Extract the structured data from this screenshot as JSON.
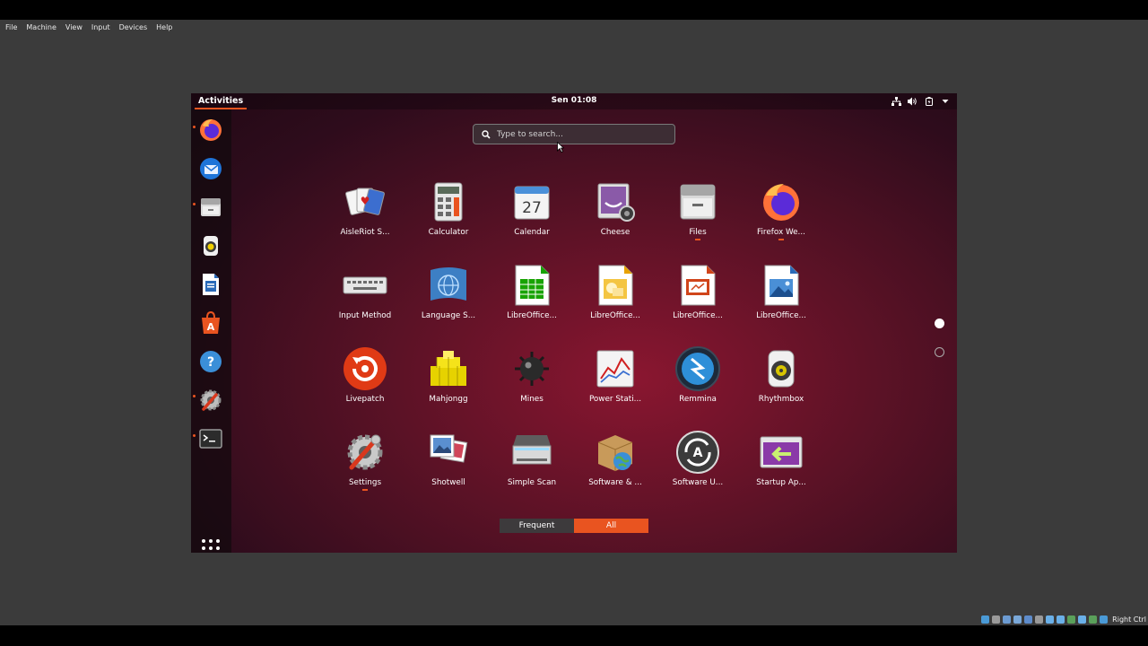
{
  "host": {
    "menu": [
      "File",
      "Machine",
      "View",
      "Input",
      "Devices",
      "Help"
    ],
    "host_key": "Right Ctrl",
    "status_icon_colors": [
      "#4a9ad6",
      "#9a9a9a",
      "#6c9bd2",
      "#7aa8d8",
      "#5e8ccb",
      "#9a9a9a",
      "#6ab0e8",
      "#6ab0e8",
      "#5aa05a",
      "#6ab0e8",
      "#5aa05a",
      "#4a9ad6"
    ]
  },
  "topbar": {
    "activities": "Activities",
    "clock": "Sen 01:08",
    "tray_icons": [
      "network-icon",
      "volume-icon",
      "battery-icon",
      "system-menu-arrow-icon"
    ]
  },
  "dock": {
    "items": [
      {
        "name": "firefox",
        "icon": "firefox-icon",
        "running": true
      },
      {
        "name": "thunderbird",
        "icon": "thunderbird-icon",
        "running": false
      },
      {
        "name": "files",
        "icon": "files-icon",
        "running": true
      },
      {
        "name": "rhythmbox",
        "icon": "rhythmbox-icon",
        "running": false
      },
      {
        "name": "libreoffice-writer",
        "icon": "writer-icon",
        "running": false
      },
      {
        "name": "ubuntu-software",
        "icon": "software-icon",
        "running": false
      },
      {
        "name": "help",
        "icon": "help-icon",
        "running": false
      },
      {
        "name": "settings",
        "icon": "settings-icon",
        "running": true
      },
      {
        "name": "terminal",
        "icon": "terminal-icon",
        "running": true
      }
    ],
    "show_apps_icon": "grid-icon"
  },
  "search": {
    "placeholder": "Type to search..."
  },
  "apps": [
    {
      "label": "AisleRiot S...",
      "icon": "cards-icon",
      "running": false
    },
    {
      "label": "Calculator",
      "icon": "calculator-icon",
      "running": false
    },
    {
      "label": "Calendar",
      "icon": "calendar-icon",
      "day": "27",
      "running": false
    },
    {
      "label": "Cheese",
      "icon": "cheese-icon",
      "running": false
    },
    {
      "label": "Files",
      "icon": "files-icon",
      "running": true
    },
    {
      "label": "Firefox We...",
      "icon": "firefox-icon",
      "running": true
    },
    {
      "label": "Input Method",
      "icon": "keyboard-icon",
      "running": false
    },
    {
      "label": "Language S...",
      "icon": "language-icon",
      "running": false
    },
    {
      "label": "LibreOffice...",
      "icon": "calc-doc-icon",
      "running": false
    },
    {
      "label": "LibreOffice...",
      "icon": "draw-doc-icon",
      "running": false
    },
    {
      "label": "LibreOffice...",
      "icon": "impress-doc-icon",
      "running": false
    },
    {
      "label": "LibreOffice...",
      "icon": "draw2-doc-icon",
      "running": false
    },
    {
      "label": "Livepatch",
      "icon": "livepatch-icon",
      "running": false
    },
    {
      "label": "Mahjongg",
      "icon": "mahjongg-icon",
      "running": false
    },
    {
      "label": "Mines",
      "icon": "mine-icon",
      "running": false
    },
    {
      "label": "Power Stati...",
      "icon": "power-stats-icon",
      "running": false
    },
    {
      "label": "Remmina",
      "icon": "remmina-icon",
      "running": false
    },
    {
      "label": "Rhythmbox",
      "icon": "rhythmbox-icon",
      "running": false
    },
    {
      "label": "Settings",
      "icon": "settings-icon",
      "running": true
    },
    {
      "label": "Shotwell",
      "icon": "shotwell-icon",
      "running": false
    },
    {
      "label": "Simple Scan",
      "icon": "scanner-icon",
      "running": false
    },
    {
      "label": "Software & ...",
      "icon": "software-sources-icon",
      "running": false
    },
    {
      "label": "Software U...",
      "icon": "software-updater-icon",
      "running": false
    },
    {
      "label": "Startup Ap...",
      "icon": "startup-apps-icon",
      "running": false
    }
  ],
  "pages": {
    "count": 2,
    "current": 1
  },
  "view_switch": {
    "frequent": "Frequent",
    "all": "All",
    "selected": "all"
  },
  "colors": {
    "accent": "#e95420",
    "background": "#5c1226"
  }
}
